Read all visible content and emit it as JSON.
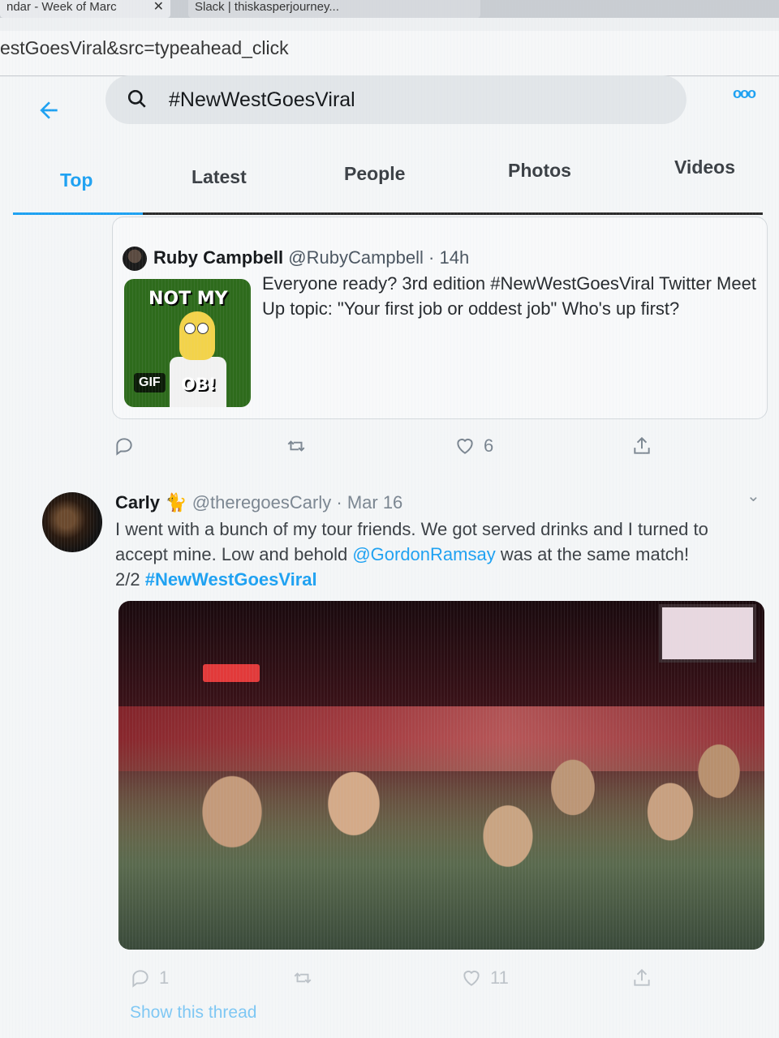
{
  "browser": {
    "tabs": [
      {
        "title": "ndar - Week of Marc",
        "close": "✕"
      },
      {
        "title": "Slack | thiskasperjourney..."
      }
    ],
    "url": "estGoesViral&src=typeahead_click"
  },
  "header": {
    "back_icon": "arrow-left-icon",
    "search_query": "#NewWestGoesViral",
    "more_label": "ooo"
  },
  "nav_tabs": [
    {
      "label": "Top",
      "active": true
    },
    {
      "label": "Latest",
      "active": false
    },
    {
      "label": "People",
      "active": false
    },
    {
      "label": "Photos",
      "active": false
    },
    {
      "label": "Videos",
      "active": false
    }
  ],
  "quoted_tweet": {
    "name": "Ruby Campbell",
    "handle": "@RubyCampbell",
    "time": "14h",
    "gif_top_text": "NOT MY",
    "gif_bottom_text": "OB!",
    "gif_badge": "GIF",
    "text": "Everyone ready? 3rd edition #NewWestGoesViral  Twitter Meet Up topic: \"Your first job or oddest job\"  Who's up first?"
  },
  "tweet1_actions": {
    "reply_count": "",
    "retweet_count": "",
    "like_count": "6"
  },
  "tweet2": {
    "name": "Carly",
    "handle": "@theregoesCarly",
    "time": "Mar 16",
    "text_before": "I went with a bunch of my tour friends. We got served drinks and I turned to accept mine. Low and behold ",
    "mention": "@GordonRamsay",
    "text_after": " was at the same match!",
    "thread_prefix": "2/2 ",
    "hashtag": "#NewWestGoesViral",
    "reply_count": "1",
    "retweet_count": "",
    "like_count": "11",
    "show_thread": "Show this thread"
  },
  "colors": {
    "accent": "#1da1f2",
    "text": "#14171a",
    "muted": "#7a8590"
  }
}
